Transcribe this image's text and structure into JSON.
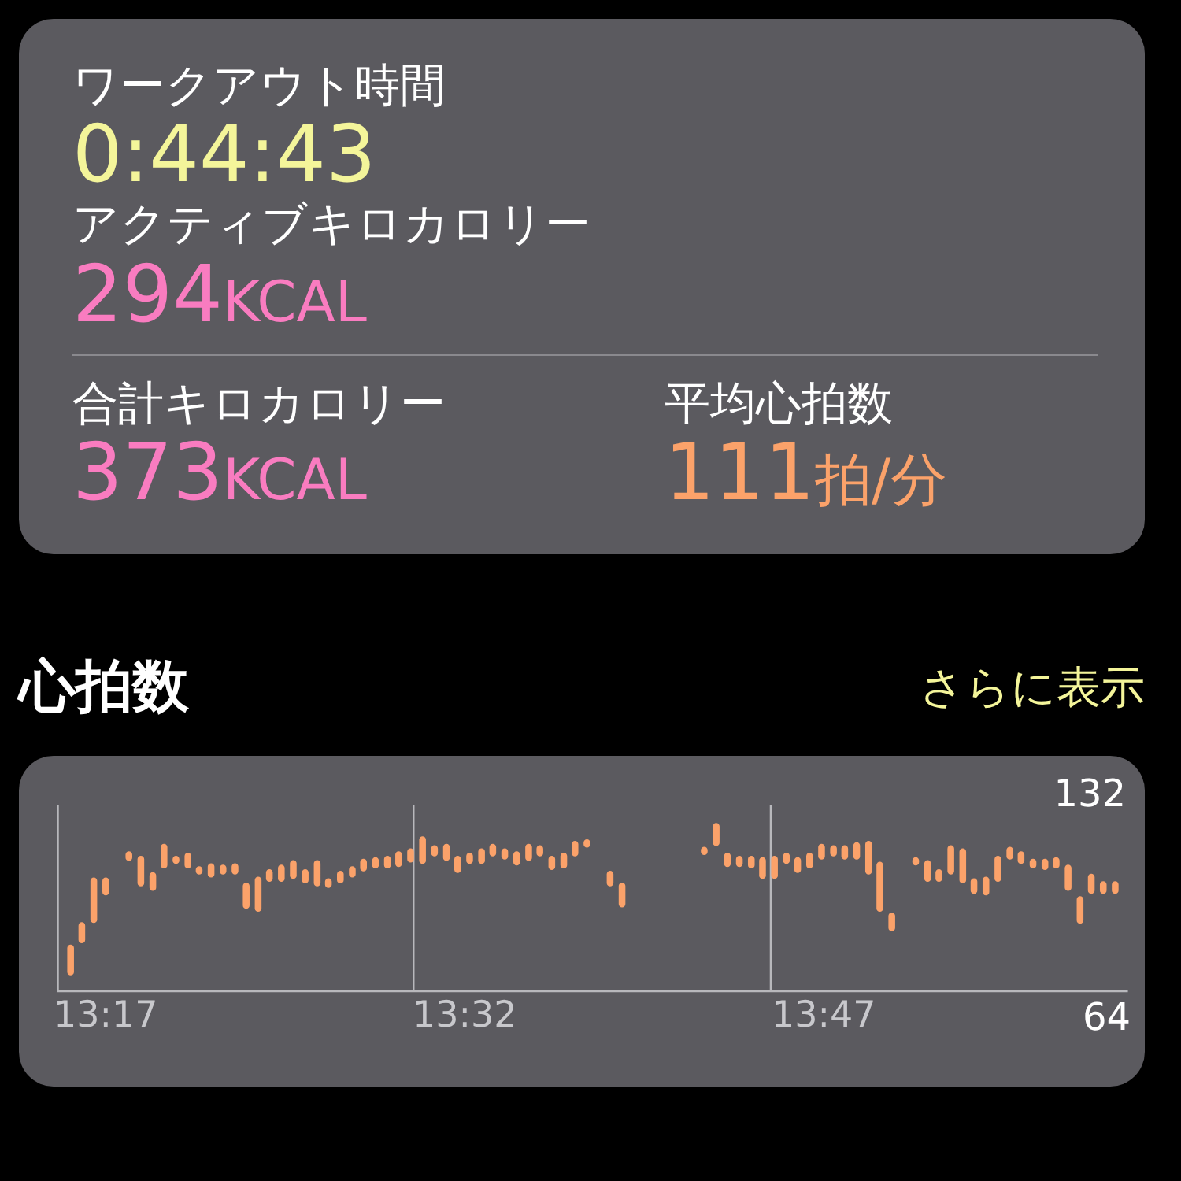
{
  "summary": {
    "wide_metrics": [
      {
        "label": "ワークアウト時間",
        "value": "0:44:43",
        "color": "#f4f59a"
      },
      {
        "label": "アクティブキロカロリー",
        "value": "294",
        "unit": "KCAL",
        "color": "#f97cc0"
      }
    ],
    "paired_metrics": [
      {
        "label": "合計キロカロリー",
        "value": "373",
        "unit": "KCAL",
        "color": "#f97cc0"
      },
      {
        "label": "平均心拍数",
        "value": "111",
        "unit": "拍/分",
        "color": "#fba26a"
      }
    ]
  },
  "heart_rate": {
    "title": "心拍数",
    "more_link": "さらに表示",
    "chart": {
      "y_max_label": "132",
      "y_min_label": "64",
      "x_labels": [
        "13:17",
        "13:32",
        "13:47"
      ]
    }
  }
}
